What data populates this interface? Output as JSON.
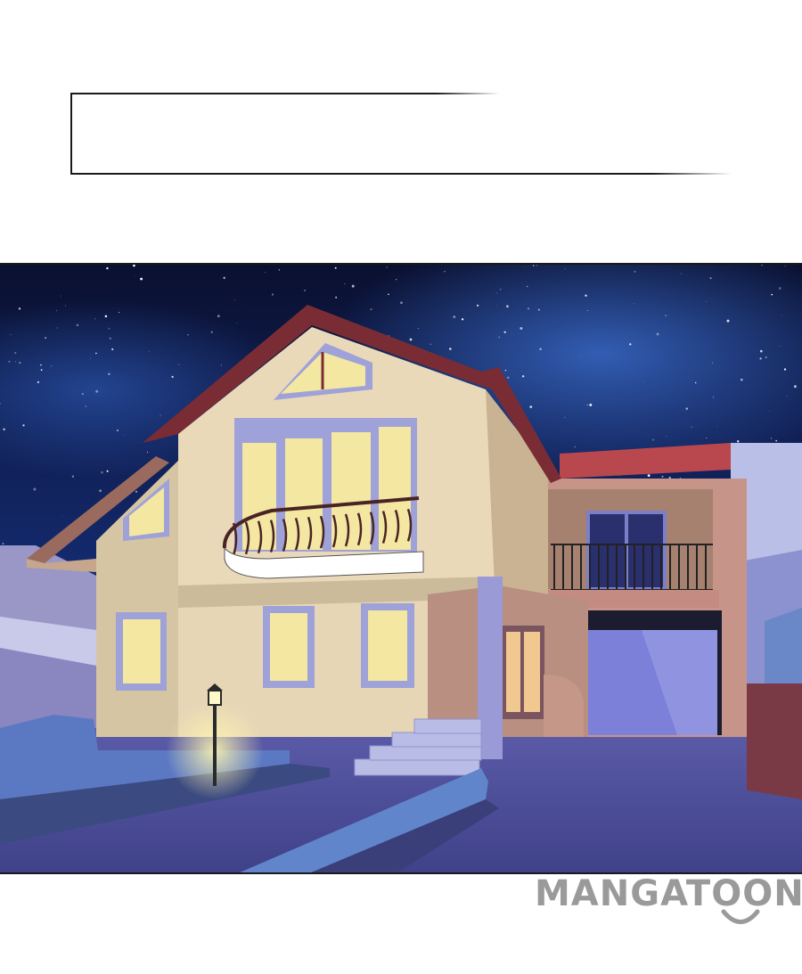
{
  "watermark": {
    "text": "MANGATOON"
  },
  "colors": {
    "sky_dark": "#0b1233",
    "sky_mid": "#1b3a86",
    "house_wall": "#e7d7b8",
    "roof": "#7a2c35",
    "window_glow": "#f3e7a2",
    "garage_door": "#7b7fd6",
    "ground": "#4a4c9a",
    "watermark": "#9a9a9a"
  },
  "icons": [
    "street-lamp-icon",
    "smile-logo-icon"
  ]
}
